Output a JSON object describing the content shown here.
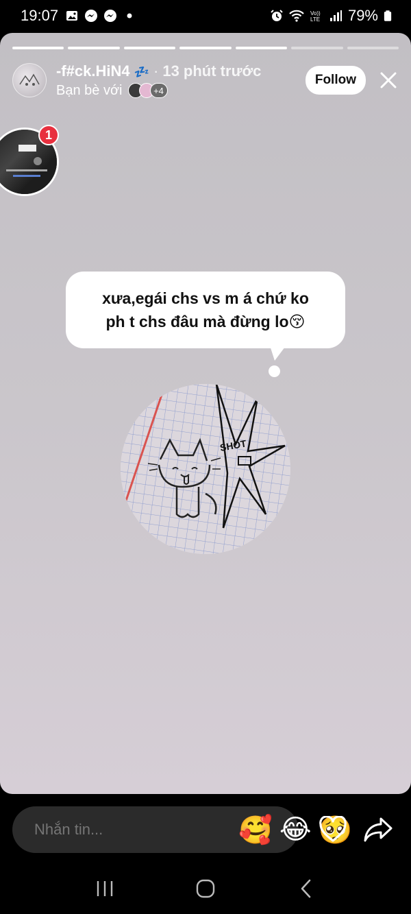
{
  "status_bar": {
    "time": "19:07",
    "battery": "79%",
    "left_icons": [
      "gallery-icon",
      "messenger-icon",
      "messenger-icon",
      "dot-icon"
    ],
    "right_icons": [
      "alarm-icon",
      "wifi-icon",
      "volte-icon",
      "signal-icon",
      "battery-icon"
    ]
  },
  "story": {
    "progress_total": 7,
    "progress_done": 5,
    "username": "-f#ck.HiN4",
    "username_emoji": "💤",
    "separator": "·",
    "time_ago": "13 phút trước",
    "friends_label": "Bạn bè với",
    "friends_more": "+4",
    "follow_label": "Follow",
    "notification_count": "1",
    "caption_line1": "xưa,egái chs vs m á chứ ko",
    "caption_line2": "ph t chs đâu mà đừng lo😚",
    "background_colors": [
      "#c2bfc4",
      "#d6ced6"
    ]
  },
  "reply_bar": {
    "placeholder": "Nhắn tin...",
    "emojis": [
      "🥰",
      "😂",
      "🥺"
    ]
  },
  "nav_bar": {
    "items": [
      "recent-apps-icon",
      "home-icon",
      "back-icon"
    ]
  }
}
